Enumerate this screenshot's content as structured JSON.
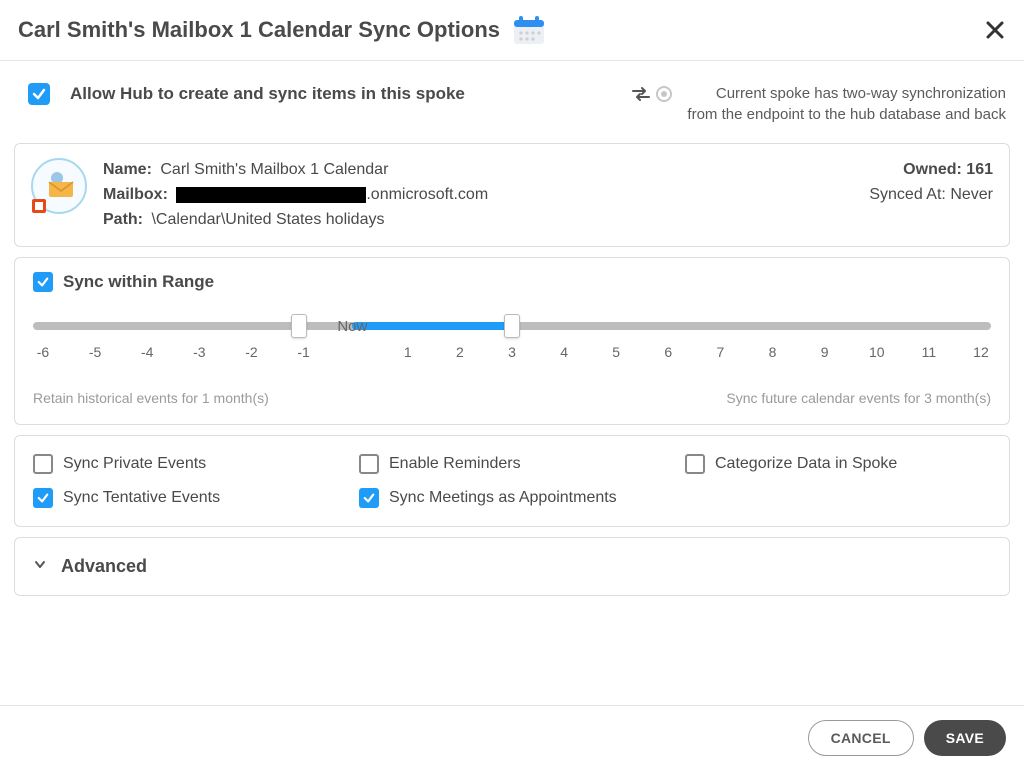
{
  "header": {
    "title": "Carl Smith's Mailbox 1 Calendar Sync Options"
  },
  "allow_block": {
    "checked": true,
    "label": "Allow Hub to create and sync items in this spoke"
  },
  "sync_mode": {
    "line1": "Current spoke has two-way synchronization",
    "line2": "from the endpoint to the hub database and back"
  },
  "info": {
    "name_label": "Name:",
    "name_value": "Carl Smith's Mailbox 1 Calendar",
    "mailbox_label": "Mailbox:",
    "mailbox_suffix": ".onmicrosoft.com",
    "path_label": "Path:",
    "path_value": "\\Calendar\\United States holidays",
    "owned_label": "Owned:",
    "owned_value": "161",
    "synced_label": "Synced At:",
    "synced_value": "Never"
  },
  "range": {
    "checked": true,
    "label": "Sync within Range",
    "now_label": "Now",
    "min": -6,
    "max": 12,
    "handle_low": -1,
    "handle_high": 3,
    "ticks": [
      "-6",
      "-5",
      "-4",
      "-3",
      "-2",
      "-1",
      "",
      "1",
      "2",
      "3",
      "4",
      "5",
      "6",
      "7",
      "8",
      "9",
      "10",
      "11",
      "12"
    ],
    "retain_text": "Retain historical events for 1 month(s)",
    "future_text": "Sync future calendar events for 3 month(s)"
  },
  "options": {
    "sync_private": {
      "checked": false,
      "label": "Sync Private Events"
    },
    "enable_reminders": {
      "checked": false,
      "label": "Enable Reminders"
    },
    "categorize": {
      "checked": false,
      "label": "Categorize Data in Spoke"
    },
    "sync_tentative": {
      "checked": true,
      "label": "Sync Tentative Events"
    },
    "sync_meetings": {
      "checked": true,
      "label": "Sync Meetings as Appointments"
    }
  },
  "advanced": {
    "label": "Advanced",
    "expanded": false
  },
  "footer": {
    "cancel": "CANCEL",
    "save": "SAVE"
  }
}
